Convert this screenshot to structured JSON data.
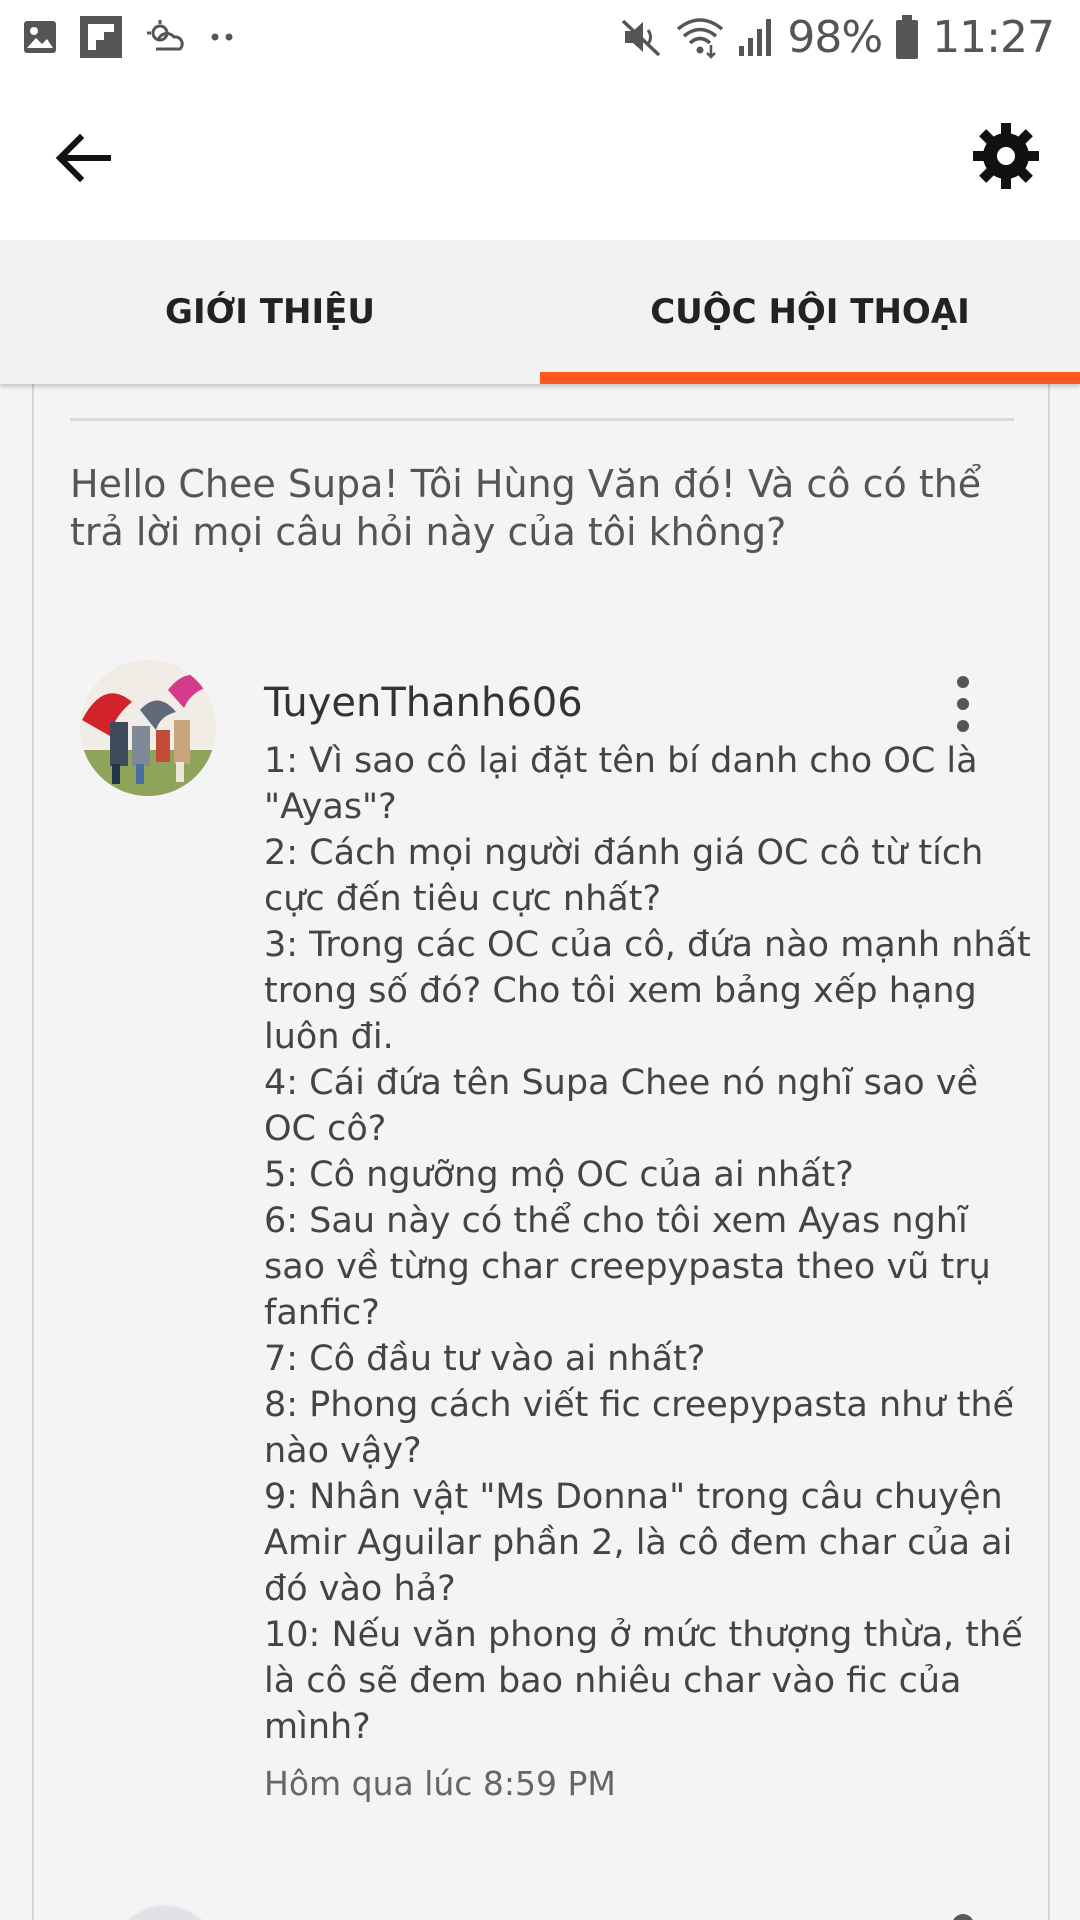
{
  "status_bar": {
    "battery": "98%",
    "time": "11:27",
    "left_icons": [
      "gallery-icon",
      "flipboard-icon",
      "weather-icon",
      "more-dots-icon"
    ],
    "right_icons": [
      "mute-icon",
      "wifi-icon",
      "signal-icon",
      "battery-icon"
    ]
  },
  "app_bar": {
    "back_icon": "arrow-back-icon",
    "settings_icon": "gear-icon"
  },
  "tabs": [
    {
      "label": "GIỚI THIỆU",
      "selected": false
    },
    {
      "label": "CUỘC HỘI THOẠI",
      "selected": true
    }
  ],
  "colors": {
    "accent": "#ff5722",
    "background": "#f4f4f4",
    "text": "#444444"
  },
  "conversation": {
    "intro": "Hello Chee Supa! Tôi Hùng Văn đó! Và cô có thể trả lời mọi câu hỏi này của tôi không?",
    "comment": {
      "username": "TuyenThanh606",
      "lines": [
        "1: Vì sao cô lại đặt tên bí danh cho OC là \"Ayas\"?",
        "2: Cách mọi người đánh giá OC cô từ tích cực đến tiêu cực nhất?",
        "3: Trong các OC của cô, đứa nào mạnh nhất trong số đó? Cho tôi xem bảng xếp hạng luôn đi.",
        "4: Cái đứa tên Supa Chee nó nghĩ sao về OC cô?",
        "5: Cô ngưỡng mộ OC của ai nhất?",
        "6: Sau này có thể cho tôi xem Ayas nghĩ sao về từng char creepypasta theo vũ trụ fanfic?",
        "7: Cô đầu tư vào ai nhất?",
        "8: Phong cách viết fic creepypasta như thế nào vậy?",
        "9: Nhân vật \"Ms Donna\" trong câu chuyện Amir Aguilar phần 2, là cô đem char của ai đó vào hả?",
        "10: Nếu văn phong ở mức thượng thừa, thế là cô sẽ đem bao nhiêu char vào fic của mình?"
      ],
      "timestamp": "Hôm qua lúc 8:59 PM"
    }
  }
}
